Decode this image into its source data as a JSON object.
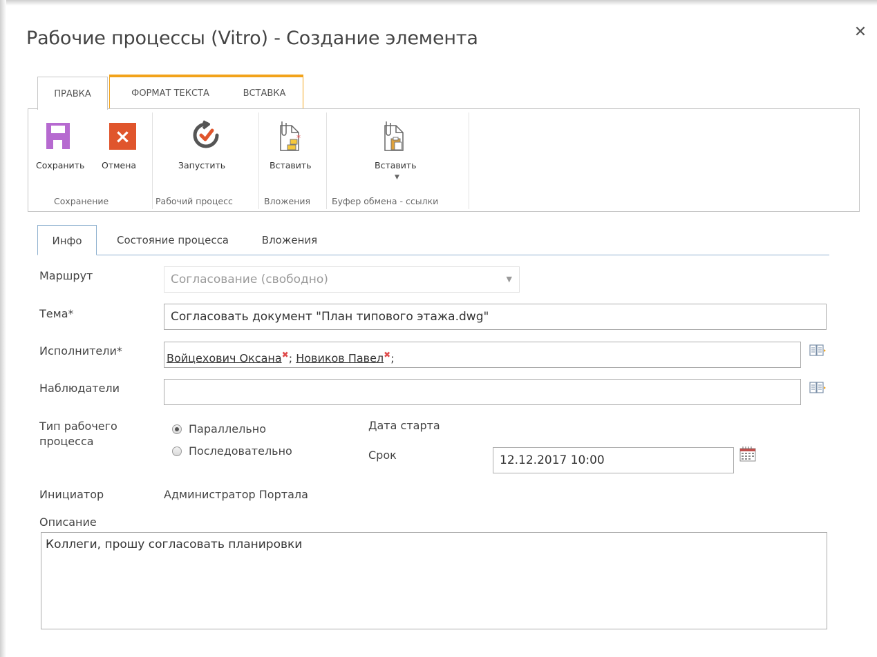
{
  "dialog": {
    "title": "Рабочие процессы (Vitro) - Создание элемента",
    "close_glyph": "✕"
  },
  "ribbon": {
    "tabs": [
      {
        "label": "ПРАВКА",
        "active": true
      },
      {
        "label": "ФОРМАТ ТЕКСТА",
        "active": false
      },
      {
        "label": "ВСТАВКА",
        "active": false
      }
    ],
    "accent_color": "#f2a31a",
    "groups": {
      "save": {
        "label": "Сохранение",
        "buttons": {
          "save": "Сохранить",
          "cancel": "Отмена"
        }
      },
      "workflow": {
        "label": "Рабочий процесс",
        "buttons": {
          "run": "Запустить"
        }
      },
      "attachments": {
        "label": "Вложения",
        "buttons": {
          "insert": "Вставить"
        }
      },
      "clipboard": {
        "label": "Буфер обмена - ссылки",
        "buttons": {
          "insert": "Вставить"
        }
      }
    },
    "icons": {
      "save": "save-icon",
      "cancel": "cancel-icon",
      "run": "run-workflow-icon",
      "attach": "attach-file-icon",
      "paste_link": "paste-link-icon"
    }
  },
  "content_tabs": [
    {
      "label": "Инфо",
      "active": true
    },
    {
      "label": "Состояние процесса",
      "active": false
    },
    {
      "label": "Вложения",
      "active": false
    }
  ],
  "form": {
    "route": {
      "label": "Маршрут",
      "value": "Согласование (свободно)"
    },
    "subject": {
      "label": "Тема*",
      "value": "Согласовать документ \"План типового этажа.dwg\""
    },
    "executors": {
      "label": "Исполнители*",
      "people": [
        {
          "name": "Войцехович Оксана",
          "separator": "; "
        },
        {
          "name": "Новиков Павел",
          "separator": ";"
        }
      ]
    },
    "observers": {
      "label": "Наблюдатели",
      "value": ""
    },
    "workflow_type": {
      "label": "Тип рабочего процесса",
      "options": [
        {
          "label": "Параллельно",
          "checked": true
        },
        {
          "label": "Последовательно",
          "checked": false
        }
      ]
    },
    "start_date": {
      "label": "Дата старта"
    },
    "deadline": {
      "label": "Срок",
      "value": "12.12.2017 10:00"
    },
    "initiator": {
      "label": "Инициатор",
      "value": "Администратор Портала"
    },
    "description": {
      "label": "Описание",
      "value": "Коллеги, прошу согласовать планировки"
    }
  }
}
